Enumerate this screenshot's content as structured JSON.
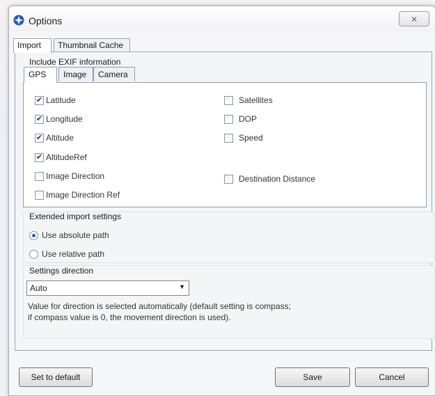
{
  "window": {
    "title": "Options",
    "close_glyph": "⨯"
  },
  "tabs": [
    "Import",
    "Thumbnail Cache"
  ],
  "exif": {
    "group_label": "Include EXIF information",
    "subtabs": [
      "GPS",
      "Image",
      "Camera"
    ],
    "left_column": [
      {
        "label": "Latitude",
        "checked": true
      },
      {
        "label": "Longitude",
        "checked": true
      },
      {
        "label": "Altitude",
        "checked": true
      },
      {
        "label": "AltitudeRef",
        "checked": true
      },
      {
        "label": "Image Direction",
        "checked": false
      },
      {
        "label": "Image Direction Ref",
        "checked": false
      }
    ],
    "right_column": [
      {
        "label": "Satellites",
        "checked": false
      },
      {
        "label": "DOP",
        "checked": false
      },
      {
        "label": "Speed",
        "checked": false
      },
      {
        "label": "Destination Distance",
        "checked": false
      }
    ]
  },
  "extended": {
    "label": "Extended import settings",
    "options": [
      {
        "label": "Use absolute path",
        "selected": true
      },
      {
        "label": "Use relative path",
        "selected": false
      }
    ]
  },
  "direction": {
    "label": "Settings direction",
    "selected": "Auto",
    "description_line1": "Value for direction is selected automatically (default setting is compass;",
    "description_line2": "if compass value is 0, the movement direction is used)."
  },
  "buttons": {
    "reset": "Set to default",
    "save": "Save",
    "cancel": "Cancel"
  },
  "icons": {
    "app": "options-app-icon",
    "close": "close-icon",
    "dropdown": "dropdown-arrow-icon",
    "check": "checkmark-icon"
  },
  "colors": {
    "accent": "#2a5db0",
    "panel": "#ffffff",
    "frame": "#f5f6f8"
  }
}
